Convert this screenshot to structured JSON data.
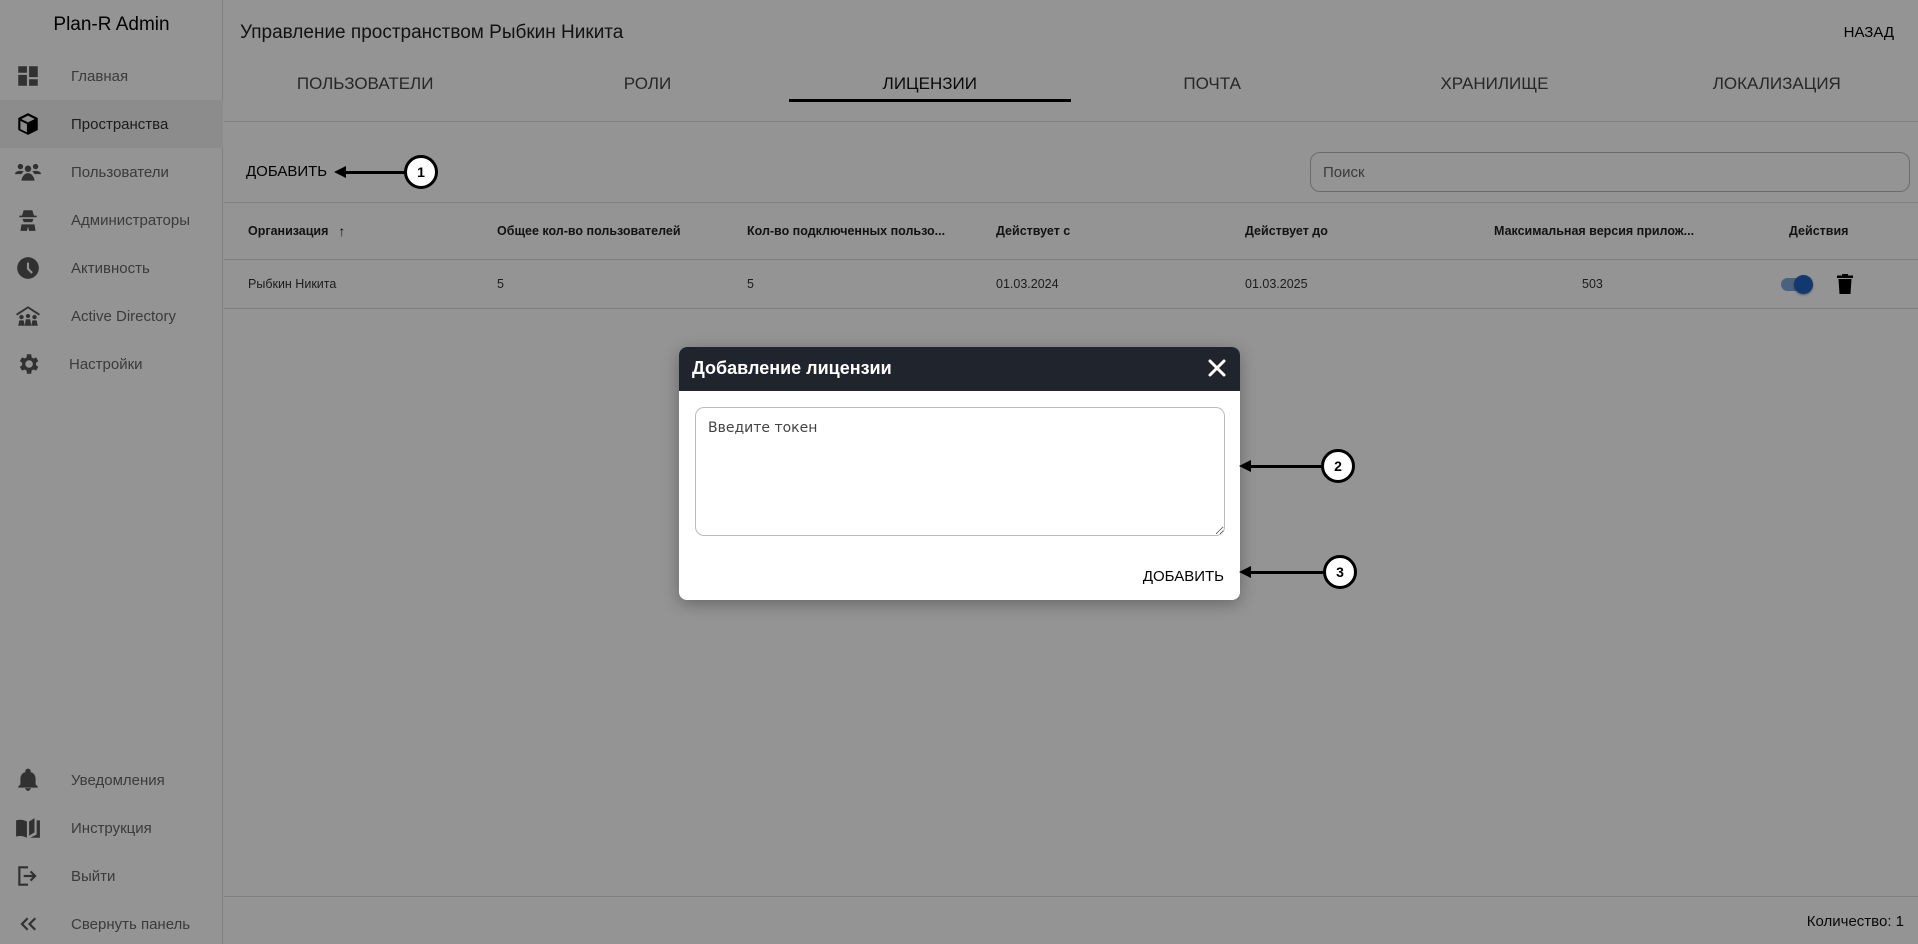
{
  "app": {
    "brand": "Plan-R Admin"
  },
  "sidebar": {
    "items": [
      {
        "label": "Главная",
        "icon": "dashboard-icon"
      },
      {
        "label": "Пространства",
        "icon": "cube-icon",
        "active": true
      },
      {
        "label": "Пользователи",
        "icon": "users-icon"
      },
      {
        "label": "Администраторы",
        "icon": "spy-icon"
      },
      {
        "label": "Активность",
        "icon": "clock-icon"
      },
      {
        "label": "Active Directory",
        "icon": "house-users-icon"
      },
      {
        "label": "Настройки",
        "icon": "gear-icon"
      }
    ],
    "bottom_items": [
      {
        "label": "Уведомления",
        "icon": "bell-icon"
      },
      {
        "label": "Инструкция",
        "icon": "book-icon"
      },
      {
        "label": "Выйти",
        "icon": "logout-icon"
      },
      {
        "label": "Свернуть панель",
        "icon": "collapse-icon"
      }
    ]
  },
  "header": {
    "title": "Управление пространством Рыбкин Никита",
    "back_label": "НАЗАД"
  },
  "tabs": [
    {
      "label": "ПОЛЬЗОВАТЕЛИ"
    },
    {
      "label": "РОЛИ"
    },
    {
      "label": "ЛИЦЕНЗИИ",
      "active": true
    },
    {
      "label": "ПОЧТА"
    },
    {
      "label": "ХРАНИЛИЩЕ"
    },
    {
      "label": "ЛОКАЛИЗАЦИЯ"
    }
  ],
  "toolbar": {
    "add_label": "ДОБАВИТЬ",
    "search_placeholder": "Поиск"
  },
  "table": {
    "columns": [
      "Организация",
      "Общее кол-во пользователей",
      "Кол-во подключенных пользо...",
      "Действует с",
      "Действует до",
      "Максимальная версия прилож...",
      "Действия"
    ],
    "sort": {
      "column": "Организация",
      "direction": "asc",
      "icon": "↑"
    },
    "rows": [
      {
        "organization": "Рыбкин Никита",
        "total_users": "5",
        "connected_users": "5",
        "valid_from": "01.03.2024",
        "valid_to": "01.03.2025",
        "max_version": "503",
        "enabled": true
      }
    ]
  },
  "footer": {
    "count_label": "Количество: 1"
  },
  "dialog": {
    "title": "Добавление лицензии",
    "token_placeholder": "Введите токен",
    "token_value": "",
    "add_label": "ДОБАВИТЬ"
  },
  "callouts": [
    "1",
    "2",
    "3"
  ],
  "colors": {
    "dialog_header": "#20252d",
    "toggle_on": "#1e62c0",
    "overlay": "rgba(0,0,0,0.42)"
  }
}
